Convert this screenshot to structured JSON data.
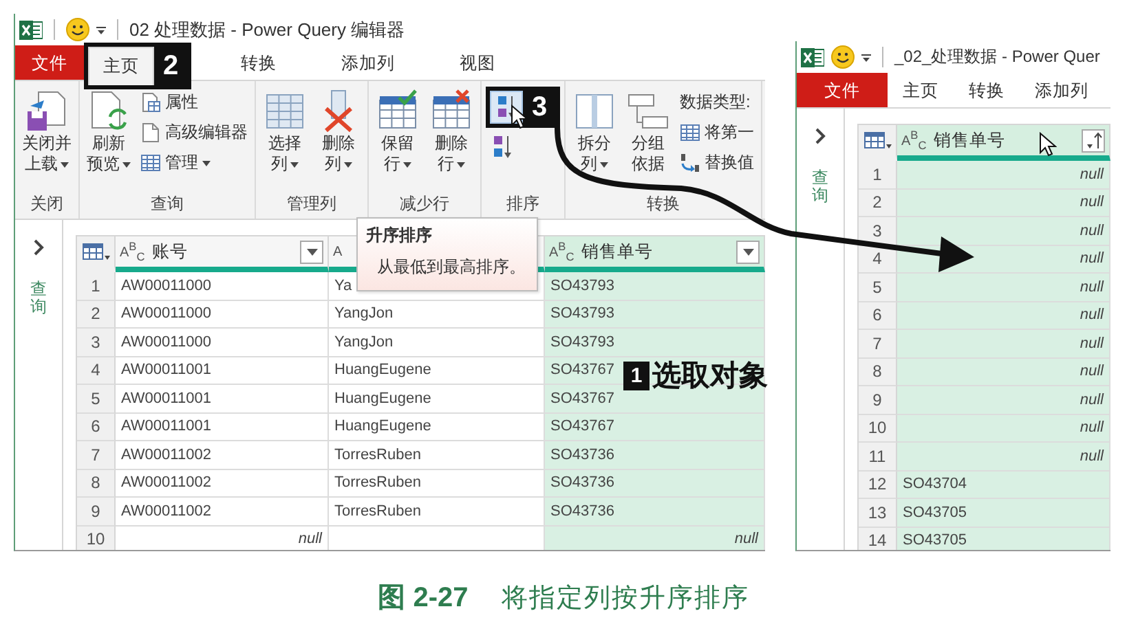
{
  "left_window": {
    "title": "02 处理数据 - Power Query 编辑器",
    "tabs": [
      {
        "label": "文件",
        "kind": "file",
        "selected": false
      },
      {
        "label": "主页",
        "kind": "tab",
        "selected": true,
        "callout": "2"
      },
      {
        "label": "转换",
        "kind": "tab",
        "selected": false
      },
      {
        "label": "添加列",
        "kind": "tab",
        "selected": false
      },
      {
        "label": "视图",
        "kind": "tab",
        "selected": false
      }
    ],
    "ribbon": {
      "groups": [
        {
          "label": "关闭",
          "items": [
            {
              "kind": "large",
              "lines": [
                "关闭并",
                "上载"
              ],
              "dropdown": true
            }
          ]
        },
        {
          "label": "查询",
          "items": [
            {
              "kind": "large",
              "lines": [
                "刷新",
                "预览"
              ],
              "dropdown": true
            },
            {
              "kind": "stack",
              "entries": [
                {
                  "label": "属性",
                  "dropdown": false
                },
                {
                  "label": "高级编辑器",
                  "dropdown": false
                },
                {
                  "label": "管理",
                  "dropdown": true
                }
              ]
            }
          ]
        },
        {
          "label": "管理列",
          "items": [
            {
              "kind": "large",
              "lines": [
                "选择",
                "列"
              ],
              "dropdown": true
            },
            {
              "kind": "large",
              "lines": [
                "删除",
                "列"
              ],
              "dropdown": true
            }
          ]
        },
        {
          "label": "减少行",
          "items": [
            {
              "kind": "large",
              "lines": [
                "保留",
                "行"
              ],
              "dropdown": true
            },
            {
              "kind": "large",
              "lines": [
                "删除",
                "行"
              ],
              "dropdown": true
            }
          ]
        },
        {
          "label": "排序",
          "items": [
            {
              "kind": "sort",
              "buttons": [
                {
                  "hovered": true,
                  "callout": "3"
                },
                {
                  "hovered": false
                }
              ]
            }
          ]
        },
        {
          "label": "转换",
          "items": [
            {
              "kind": "large",
              "lines": [
                "拆分",
                "列"
              ],
              "dropdown": true
            },
            {
              "kind": "large",
              "lines": [
                "分组",
                "依据"
              ],
              "dropdown": false
            },
            {
              "kind": "stack",
              "entries": [
                {
                  "label": "数据类型:",
                  "dropdown": false
                },
                {
                  "label": "将第一",
                  "dropdown": false
                },
                {
                  "label": "替换值",
                  "dropdown": false
                }
              ]
            }
          ]
        }
      ]
    },
    "pane_label": "查询",
    "table": {
      "columns": [
        {
          "type": "A$^{B}$$_{C}$",
          "label": "账号",
          "selected": false,
          "sorted": false
        },
        {
          "type": "A",
          "selected": false
        },
        {
          "type": "A$^{B}$$_{C}$",
          "label": "销售单号",
          "selected": true,
          "sorted": false
        }
      ],
      "rows": [
        {
          "number": "1",
          "cells": [
            {
              "text": "AW00011000"
            },
            {
              "text": "Ya"
            },
            {
              "text": "SO43793"
            }
          ]
        },
        {
          "number": "2",
          "cells": [
            {
              "text": "AW00011000"
            },
            {
              "text": "YangJon"
            },
            {
              "text": "SO43793"
            }
          ]
        },
        {
          "number": "3",
          "cells": [
            {
              "text": "AW00011000"
            },
            {
              "text": "YangJon"
            },
            {
              "text": "SO43793"
            }
          ]
        },
        {
          "number": "4",
          "cells": [
            {
              "text": "AW00011001"
            },
            {
              "text": "HuangEugene"
            },
            {
              "text": "SO43767"
            }
          ]
        },
        {
          "number": "5",
          "cells": [
            {
              "text": "AW00011001"
            },
            {
              "text": "HuangEugene"
            },
            {
              "text": "SO43767"
            }
          ]
        },
        {
          "number": "6",
          "cells": [
            {
              "text": "AW00011001"
            },
            {
              "text": "HuangEugene"
            },
            {
              "text": "SO43767"
            }
          ]
        },
        {
          "number": "7",
          "cells": [
            {
              "text": "AW00011002"
            },
            {
              "text": "TorresRuben"
            },
            {
              "text": "SO43736"
            }
          ]
        },
        {
          "number": "8",
          "cells": [
            {
              "text": "AW00011002"
            },
            {
              "text": "TorresRuben"
            },
            {
              "text": "SO43736"
            }
          ]
        },
        {
          "number": "9",
          "cells": [
            {
              "text": "AW00011002"
            },
            {
              "text": "TorresRuben"
            },
            {
              "text": "SO43736"
            }
          ]
        },
        {
          "number": "10",
          "cells": [
            {
              "text": "null",
              "kind": "null"
            },
            {},
            {
              "text": "null",
              "kind": "null"
            }
          ]
        }
      ]
    },
    "tooltip": {
      "title": "升序排序",
      "body": "从最低到最高排序。"
    }
  },
  "right_window": {
    "title": "_02_处理数据 - Power Quer",
    "tabs": [
      {
        "label": "文件",
        "kind": "file",
        "selected": false
      },
      {
        "label": "主页",
        "kind": "tab",
        "selected": false
      },
      {
        "label": "转换",
        "kind": "tab",
        "selected": false
      },
      {
        "label": "添加列",
        "kind": "tab",
        "selected": false
      }
    ],
    "pane_label": "查询",
    "table": {
      "columns": [
        {
          "type": "A$^{B}$$_{C}$",
          "label": "销售单号",
          "selected": true,
          "sorted": true
        }
      ],
      "rows": [
        {
          "number": "1",
          "cells": [
            {
              "text": "null",
              "kind": "null"
            }
          ]
        },
        {
          "number": "2",
          "cells": [
            {
              "text": "null",
              "kind": "null"
            }
          ]
        },
        {
          "number": "3",
          "cells": [
            {
              "text": "null",
              "kind": "null"
            }
          ]
        },
        {
          "number": "4",
          "cells": [
            {
              "text": "null",
              "kind": "null"
            }
          ]
        },
        {
          "number": "5",
          "cells": [
            {
              "text": "null",
              "kind": "null"
            }
          ]
        },
        {
          "number": "6",
          "cells": [
            {
              "text": "null",
              "kind": "null"
            }
          ]
        },
        {
          "number": "7",
          "cells": [
            {
              "text": "null",
              "kind": "null"
            }
          ]
        },
        {
          "number": "8",
          "cells": [
            {
              "text": "null",
              "kind": "null"
            }
          ]
        },
        {
          "number": "9",
          "cells": [
            {
              "text": "null",
              "kind": "null"
            }
          ]
        },
        {
          "number": "10",
          "cells": [
            {
              "text": "null",
              "kind": "null"
            }
          ]
        },
        {
          "number": "11",
          "cells": [
            {
              "text": "null",
              "kind": "null"
            }
          ]
        },
        {
          "number": "12",
          "cells": [
            {
              "text": "SO43704"
            }
          ]
        },
        {
          "number": "13",
          "cells": [
            {
              "text": "SO43705"
            }
          ]
        },
        {
          "number": "14",
          "cells": [
            {
              "text": "SO43705"
            }
          ]
        }
      ]
    }
  },
  "annotation": {
    "number": "1",
    "label": "选取对象"
  },
  "caption": {
    "figure": "图 2-27",
    "text": "将指定列按升序排序"
  }
}
